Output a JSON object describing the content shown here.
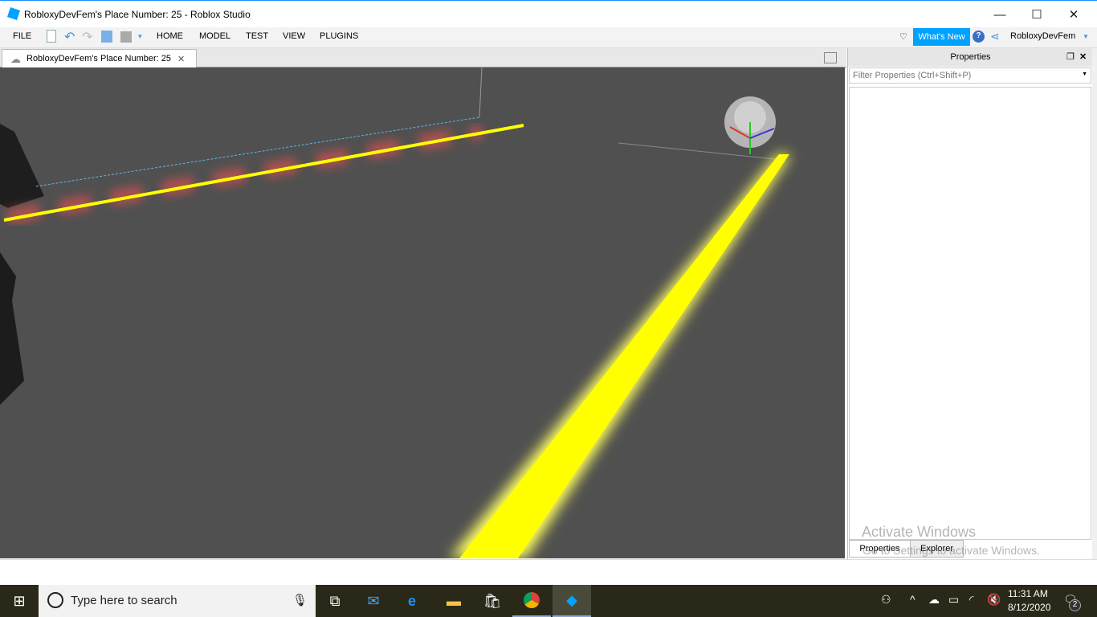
{
  "window": {
    "title": "RobloxyDevFem's Place Number: 25 - Roblox Studio",
    "minimize": "—",
    "maximize": "☐",
    "close": "✕"
  },
  "menu": {
    "file": "FILE",
    "items": [
      "HOME",
      "MODEL",
      "TEST",
      "VIEW",
      "PLUGINS"
    ],
    "whats_new": "What's New",
    "help": "?",
    "user": "RobloxyDevFem"
  },
  "doc_tab": {
    "label": "RobloxyDevFem's Place Number: 25",
    "close": "✕"
  },
  "properties": {
    "title": "Properties",
    "filter_placeholder": "Filter Properties (Ctrl+Shift+P)",
    "tabs": [
      "Properties",
      "Explorer"
    ]
  },
  "watermark": {
    "line1": "Activate Windows",
    "line2": "Go to Settings to activate Windows."
  },
  "taskbar": {
    "search_placeholder": "Type here to search",
    "time": "11:31 AM",
    "date": "8/12/2020",
    "notifications": "2"
  },
  "colors": {
    "accent": "#00a2ff",
    "viewport": "#505050",
    "neon": "#ffff00"
  }
}
